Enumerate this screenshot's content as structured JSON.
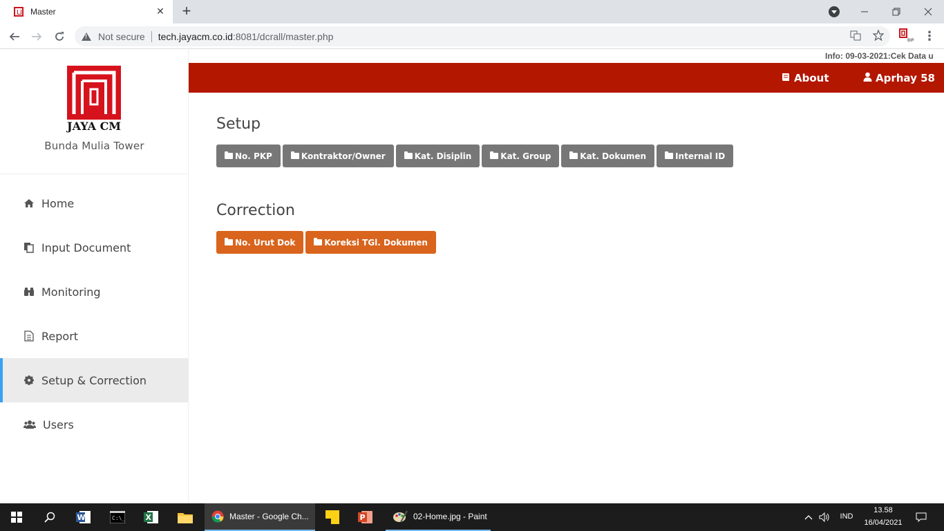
{
  "browser": {
    "tab_title": "Master",
    "tab_close": "✕",
    "new_tab": "+",
    "security_label": "Not secure",
    "url_host": "tech.jayacm.co.id",
    "url_rest": ":8081/dcrall/master.php"
  },
  "sidebar": {
    "logo_text": "JAYA CM",
    "subtitle": "Bunda Mulia Tower",
    "items": [
      {
        "label": "Home",
        "icon": "home-icon"
      },
      {
        "label": "Input Document",
        "icon": "copy-icon"
      },
      {
        "label": "Monitoring",
        "icon": "binoculars-icon"
      },
      {
        "label": "Report",
        "icon": "file-text-icon"
      },
      {
        "label": "Setup & Correction",
        "icon": "gear-icon",
        "active": true
      },
      {
        "label": "Users",
        "icon": "users-icon"
      }
    ]
  },
  "infobar": "Info: 09-03-2021:Cek Data u",
  "header": {
    "about_label": "About",
    "user_label": "Aprhay 58",
    "color": "#b31700"
  },
  "setup": {
    "title": "Setup",
    "buttons": [
      "No. PKP",
      "Kontraktor/Owner",
      "Kat. Disiplin",
      "Kat. Group",
      "Kat. Dokumen",
      "Internal ID"
    ]
  },
  "correction": {
    "title": "Correction",
    "buttons": [
      "No. Urut Dok",
      "Koreksi TGl. Dokumen"
    ]
  },
  "taskbar": {
    "chrome_label": "Master - Google Ch...",
    "paint_label": "02-Home.jpg - Paint",
    "lang": "IND",
    "time": "13.58",
    "date": "16/04/2021"
  },
  "colors": {
    "accent_blue": "#3aa0f0",
    "button_gray": "#777777",
    "button_orange": "#d9641d"
  }
}
